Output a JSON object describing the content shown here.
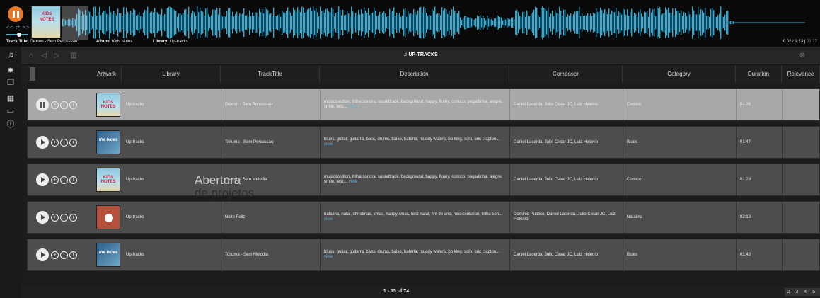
{
  "player": {
    "track_label": "Track Title:",
    "track_value": "Gexton - Sem Percussao",
    "album_label": "Album:",
    "album_value": "Kids Notes",
    "library_label": "Library:",
    "library_value": "Up-tracks",
    "time_current": "0:02 / 1:23",
    "time_total": "01:27",
    "cover_text": "KIDS NOTES",
    "controls_text": "<< ⇄ >>"
  },
  "toolbar": {
    "title": "UP-TRACKS"
  },
  "columns": [
    "Artwork",
    "Library",
    "TrackTitle",
    "Description",
    "Composer",
    "Category",
    "Duration",
    "Relevance"
  ],
  "rows": [
    {
      "art": "kids",
      "art_label": "KIDS NOTES",
      "state": "playing",
      "library": "Up-tracks",
      "title": "Gexton - Sem Percussao",
      "description": "musicsolution, trilha sonora, soundtrack, background, happy, funny, comico, pegadinha, alegre, smile, feliz...",
      "view": "view",
      "composer": "Daniel Lacerda, Julio Cesar JC, Luiz Helenio",
      "category": "Comico",
      "duration": "01:26"
    },
    {
      "art": "blue",
      "art_label": "the blues",
      "state": "paused",
      "library": "Up-tracks",
      "title": "Toliuma - Sem Percussao",
      "description": "blues, guitar, guitarra, bass, drums, baixo, bateria, muddy waters, bb king, solo, eric clapton...",
      "view": "view",
      "composer": "Daniel Lacerda, Julio Cesar JC, Luiz Helenio",
      "category": "Blues",
      "duration": "01:47"
    },
    {
      "art": "kids",
      "art_label": "KIDS NOTES",
      "state": "paused",
      "library": "Up-tracks",
      "title": "Gexton - Sem Melodia",
      "description": "musicsolution, trilha sonora, soundtrack, background, happy, funny, comico, pegadinha, alegre, smile, feliz...",
      "view": "view",
      "composer": "Daniel Lacerda, Julio Cesar JC, Luiz Helenio",
      "category": "Comico",
      "duration": "01:29"
    },
    {
      "art": "red",
      "art_label": "",
      "state": "paused",
      "library": "Up-tracks",
      "title": "Noite Feliz",
      "description": "natalina, natal, christmas, xmas, happy xmas, feliz natal, fim de ano, musicsolution, trilha son...",
      "view": "view",
      "composer": "Dominio Publico, Daniel Lacerda, Julio Cesar JC, Luiz Helenio",
      "category": "Natalina",
      "duration": "02:18"
    },
    {
      "art": "blue",
      "art_label": "the blues",
      "state": "paused",
      "library": "Up-tracks",
      "title": "Toliuma - Sem Melodia",
      "description": "blues, guitar, guitarra, bass, drums, baixo, bateria, muddy waters, bb king, solo, eric clapton...",
      "view": "view",
      "composer": "Daniel Lacerda, Julio Cesar JC, Luiz Helenio",
      "category": "Blues",
      "duration": "01:48"
    }
  ],
  "overlay": {
    "line1": "Abertura",
    "line2": "de projetos"
  },
  "footer": {
    "range": "1 - 15 of 74",
    "pages": "2 3 4 5"
  },
  "colors": {
    "accent": "#e8792b",
    "waveform": "#3aa9cf",
    "selected_row": "#a8a8a8",
    "row": "#4d4d4d"
  },
  "icons": {
    "sidebar": [
      "music-note-icon",
      "sun-icon",
      "copy-icon",
      "grid-icon",
      "folder-icon",
      "info-icon"
    ],
    "toolbar": [
      "home-icon",
      "back-icon",
      "forward-icon",
      "columns-icon",
      "close-circle-icon"
    ]
  }
}
